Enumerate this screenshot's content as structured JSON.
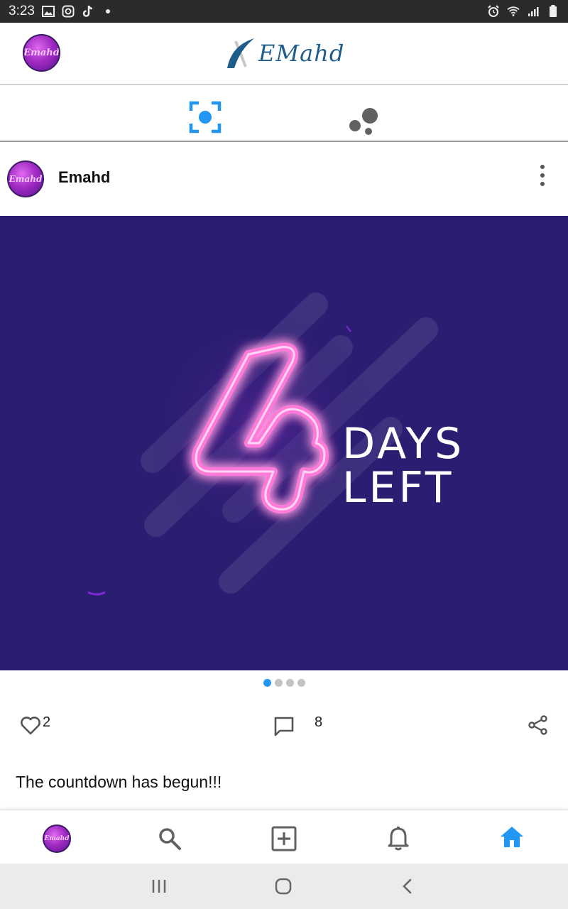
{
  "status_bar": {
    "time": "3:23"
  },
  "header": {
    "logo_text": "EMahd",
    "avatar_text": "Emahd"
  },
  "tabs": [
    {
      "icon": "scan-focus-icon",
      "active": true
    },
    {
      "icon": "bubbles-icon",
      "active": false
    }
  ],
  "post": {
    "author": "Emahd",
    "avatar_text": "Emahd",
    "image": {
      "number": "4",
      "line1": "DAYS",
      "line2": "LEFT",
      "background": "#2b1d72",
      "neon_color": "#ff4fd8"
    },
    "pager": {
      "count": 4,
      "active_index": 0
    },
    "likes": "2",
    "comments": "8",
    "caption": "The countdown has begun!!!"
  },
  "bottom_nav": {
    "items": [
      "profile",
      "search",
      "add",
      "notifications",
      "home"
    ],
    "active": "home",
    "avatar_text": "Emahd"
  },
  "colors": {
    "accent": "#2196f3",
    "icon_gray": "#616161"
  }
}
